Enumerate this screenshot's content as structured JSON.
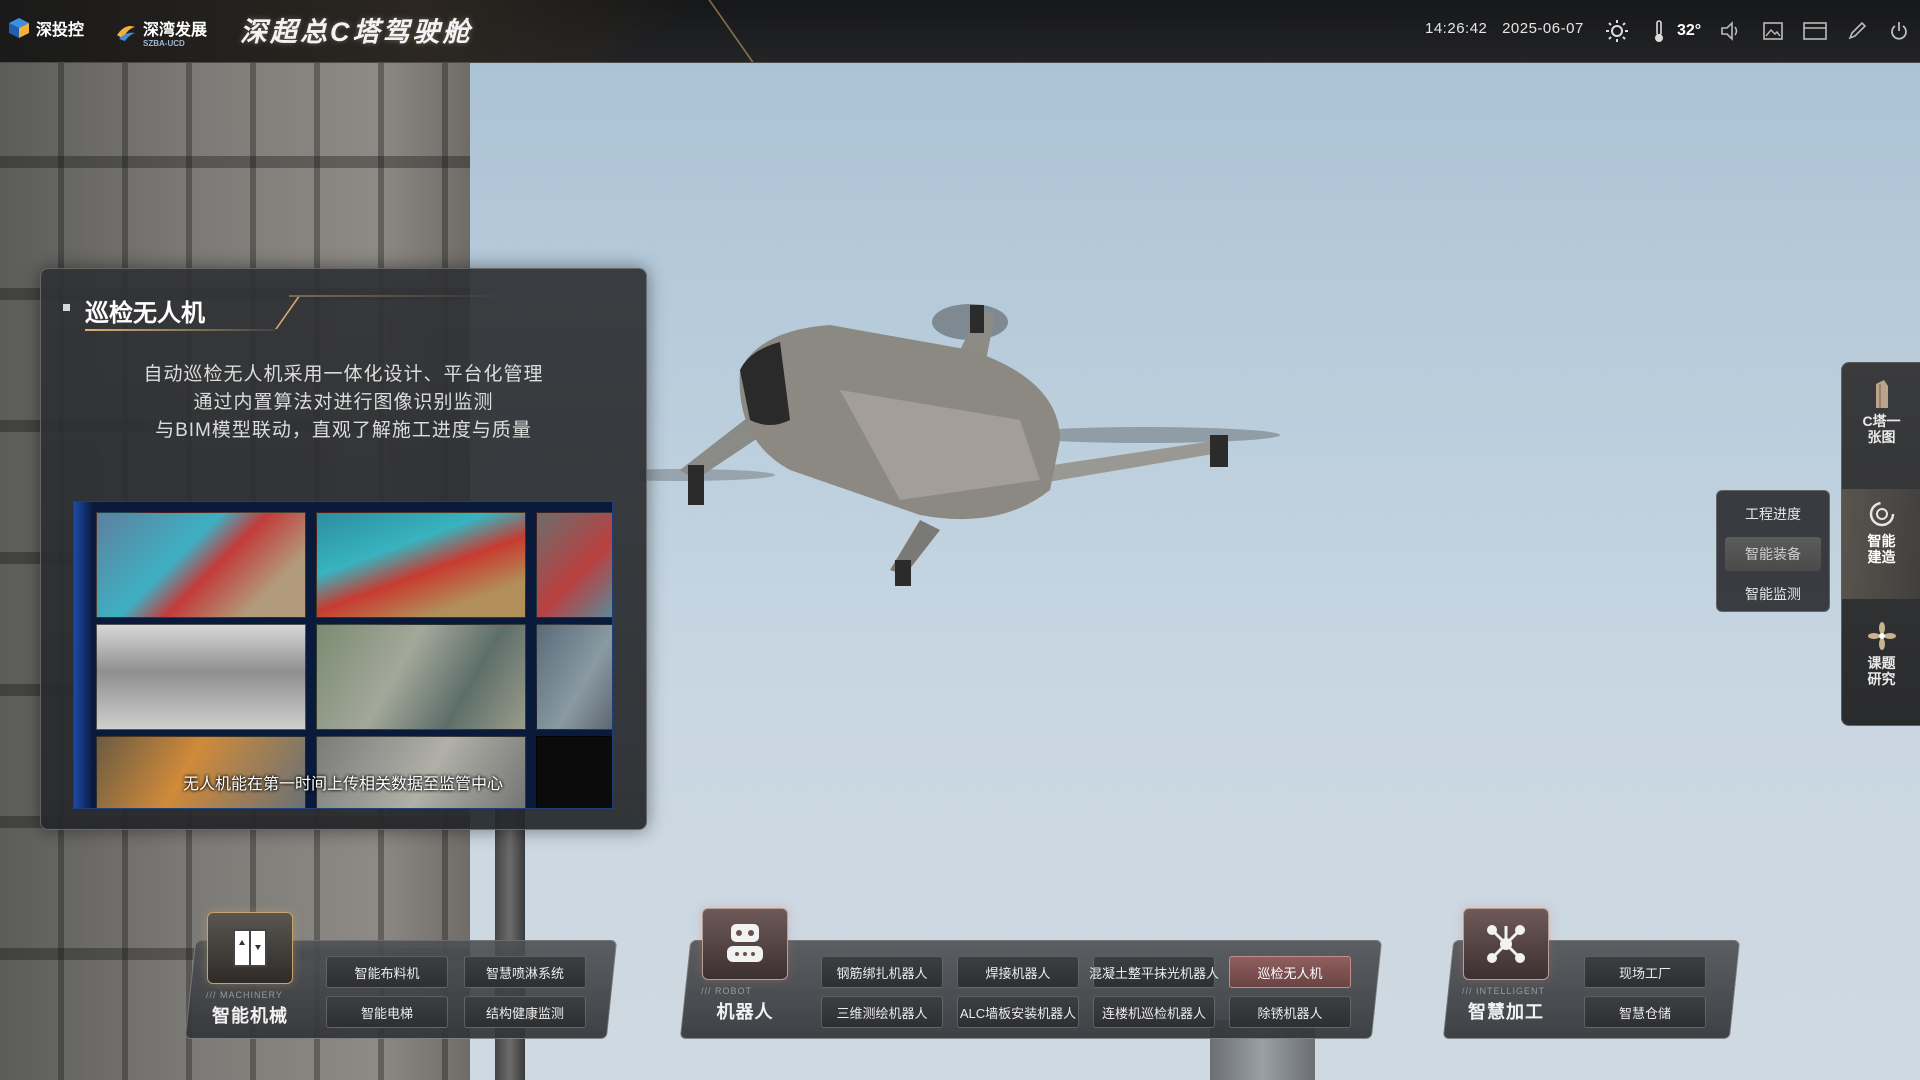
{
  "header": {
    "logos": [
      {
        "text": "深投控",
        "sub": ""
      },
      {
        "text": "深湾发展",
        "sub": "SZBA-UCD"
      }
    ],
    "title": "深超总C塔驾驶舱",
    "time": "14:26:42",
    "date": "2025-06-07",
    "temperature": "32°",
    "icons": [
      "sun-icon",
      "thermometer-icon",
      "volume-icon",
      "image-icon",
      "screen-icon",
      "pen-icon",
      "power-icon"
    ]
  },
  "panel": {
    "title": "巡检无人机",
    "desc_lines": [
      "自动巡检无人机采用一体化设计、平台化管理",
      "通过内置算法对进行图像识别监测",
      "与BIM模型联动，直观了解施工进度与质量"
    ],
    "caption": "无人机能在第一时间上传相关数据至监管中心"
  },
  "side_nav": {
    "items": [
      {
        "label": "C塔一张图",
        "icon": "tower-icon"
      },
      {
        "label": "智能建造",
        "icon": "swirl-icon",
        "active": true
      },
      {
        "label": "课题研究",
        "icon": "flower-icon"
      }
    ],
    "sub_menu": [
      {
        "label": "工程进度"
      },
      {
        "label": "智能装备",
        "active": true
      },
      {
        "label": "智能监测"
      }
    ]
  },
  "bottom": {
    "machinery": {
      "eng": "/// MACHINERY",
      "cn": "智能机械",
      "buttons": [
        "智能布料机",
        "智慧喷淋系统",
        "智能电梯",
        "结构健康监测"
      ]
    },
    "robot": {
      "eng": "/// ROBOT",
      "cn": "机器人",
      "buttons": [
        "钢筋绑扎机器人",
        "焊接机器人",
        "混凝土整平抹光机器人",
        "巡检无人机",
        "三维测绘机器人",
        "ALC墙板安装机器人",
        "连楼机巡检机器人",
        "除锈机器人"
      ],
      "active": "巡检无人机"
    },
    "intelligent": {
      "eng": "/// INTELLIGENT",
      "cn": "智慧加工",
      "buttons": [
        "现场工厂",
        "智慧仓储"
      ]
    }
  },
  "colors": {
    "accent_gold": "#c7a46b",
    "active_red": "#8f5f5f",
    "panel_bg": "#303235"
  }
}
